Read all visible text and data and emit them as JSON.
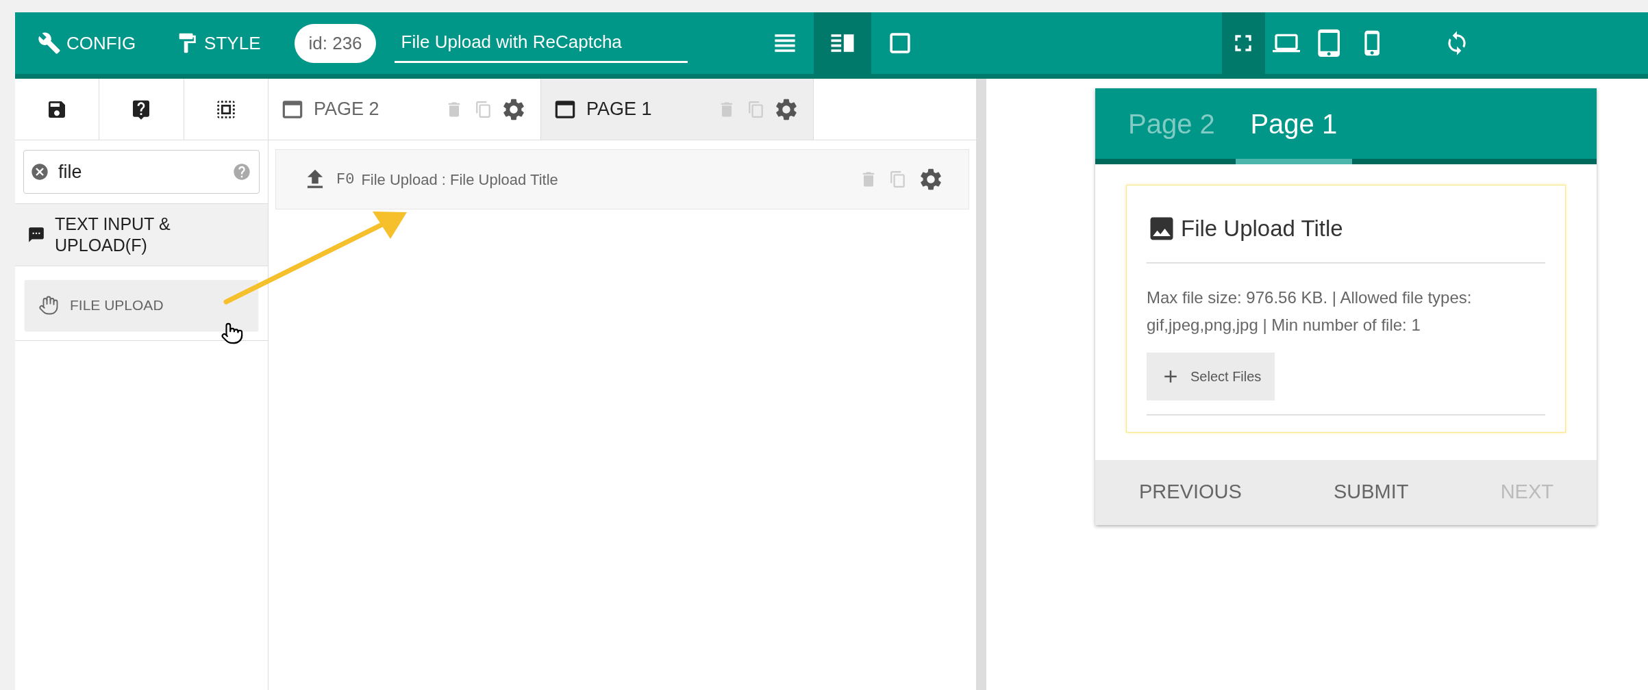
{
  "header": {
    "menu_buttons": [
      {
        "label": "CONFIG",
        "kind": "config"
      },
      {
        "label": "STYLE",
        "kind": "style"
      }
    ],
    "form_id": "id: 236",
    "form_title": {
      "value": "File Upload with ReCaptcha"
    },
    "layout_options": [
      {
        "kind": "list",
        "selected": false
      },
      {
        "kind": "split",
        "selected": true
      },
      {
        "kind": "single",
        "selected": false
      }
    ],
    "device_options": [
      {
        "kind": "fullscreen",
        "selected": true
      },
      {
        "kind": "laptop",
        "selected": false
      },
      {
        "kind": "tablet",
        "selected": false
      },
      {
        "kind": "phone",
        "selected": false
      }
    ]
  },
  "sidebar": {
    "search": {
      "value": "file"
    },
    "categories": [
      {
        "label": "TEXT INPUT & UPLOAD(F)",
        "items": [
          {
            "label": "FILE UPLOAD"
          }
        ]
      }
    ]
  },
  "page_tabs": [
    {
      "label": "PAGE 2",
      "selected": false
    },
    {
      "label": "PAGE 1",
      "selected": true
    }
  ],
  "fields": [
    {
      "code": "F0",
      "label": "File Upload : File Upload Title"
    }
  ],
  "preview": {
    "tabs": [
      {
        "label": "Page 2",
        "selected": false
      },
      {
        "label": "Page 1",
        "selected": true
      }
    ],
    "field_title": "File Upload Title",
    "help_text": "Max file size: 976.56 KB. | Allowed file types: gif,jpeg,png,jpg | Min number of file: 1",
    "select_button": "Select Files",
    "nav": [
      {
        "label": "PREVIOUS",
        "disabled": false
      },
      {
        "label": "SUBMIT",
        "disabled": false
      },
      {
        "label": "NEXT",
        "disabled": true
      }
    ]
  }
}
